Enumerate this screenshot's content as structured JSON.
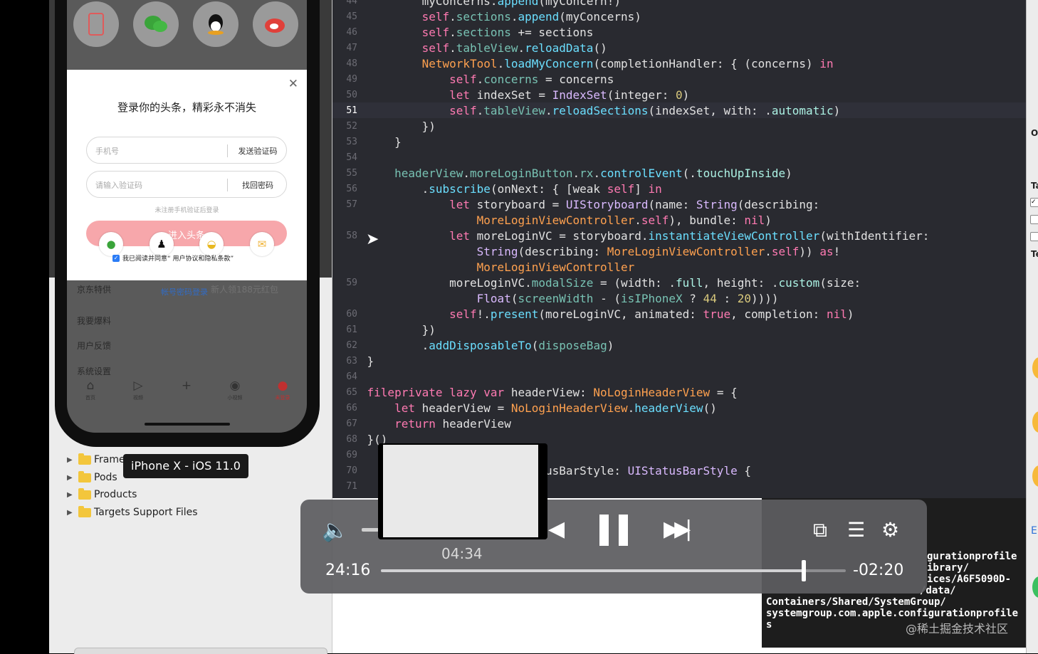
{
  "device": {
    "tooltip": "iPhone X - iOS 11.0"
  },
  "phone": {
    "share_icons": [
      "phone-icon",
      "wechat-icon",
      "qq-icon",
      "weibo-icon"
    ],
    "login": {
      "title": "登录你的头条，精彩永不消失",
      "phone_placeholder": "手机号",
      "send_code": "发送验证码",
      "code_placeholder": "请输入验证码",
      "retrieve_password": "找回密码",
      "hint": "未注册手机验证后登录",
      "enter_button": "进入头条",
      "agreement": "我已阅读并同意“ 用户协议和隐私条款”"
    },
    "menu": {
      "jd": "京东特供",
      "account_login": "帐号密码登录",
      "newbie": "新人领188元红包",
      "report": "我要爆料",
      "feedback": "用户反馈",
      "settings": "系统设置"
    },
    "tabs": [
      {
        "icon": "home-icon",
        "label": "首页"
      },
      {
        "icon": "video-icon",
        "label": "视频"
      },
      {
        "icon": "plus-icon",
        "label": ""
      },
      {
        "icon": "small-video-icon",
        "label": "小视频"
      },
      {
        "icon": "profile-icon",
        "label": "未登录"
      }
    ]
  },
  "tree": {
    "items": [
      "Frameworks",
      "Pods",
      "Products",
      "Targets Support Files"
    ]
  },
  "editor": {
    "current_line": 51
  },
  "console": {
    "lines": [
      "gurationprofile",
      "ibrary/",
      "ices/A6F5090D-",
      "/data/",
      "Containers/Shared/SystemGroup/",
      "systemgroup.com.apple.configurationprofile",
      "s"
    ],
    "watermark": "@稀土掘金技术社区"
  },
  "inspector": {
    "labels": [
      "O",
      "Ta",
      "Te",
      "E"
    ]
  },
  "player": {
    "elapsed": "24:16",
    "remaining": "-02:20",
    "preview_time": "04:34",
    "progress_fraction": 0.909,
    "volume_icon": "speaker-icon",
    "controls": [
      "rewind-icon",
      "pause-icon",
      "forward-icon",
      "pip-icon",
      "chapters-icon",
      "gear-icon"
    ]
  }
}
